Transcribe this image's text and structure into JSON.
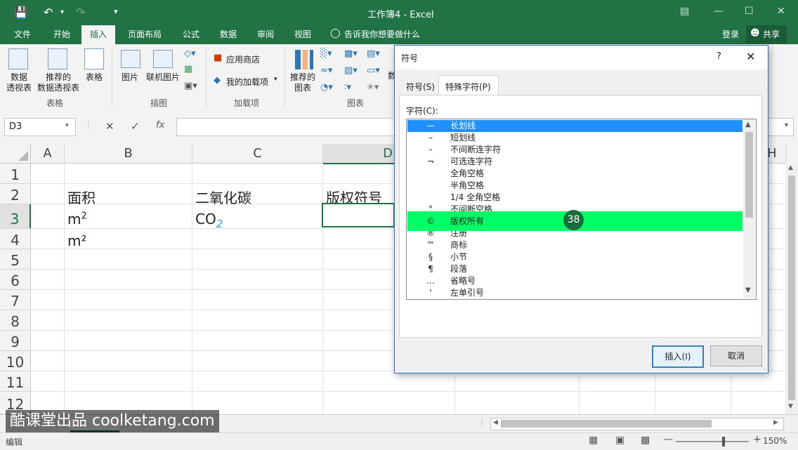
{
  "window": {
    "title": "工作簿4 - Excel"
  },
  "ribbon_tabs": [
    "文件",
    "开始",
    "插入",
    "页面布局",
    "公式",
    "数据",
    "审阅",
    "视图"
  ],
  "tell_me": "告诉我你想要做什么",
  "account": {
    "login": "登录",
    "share": "共享"
  },
  "ribbon": {
    "tables": {
      "pivot": "数据\n透视表",
      "recommended_pivot": "推荐的\n数据透视表",
      "table": "表格",
      "group": "表格"
    },
    "illustrations": {
      "pictures": "图片",
      "online_pictures": "联机图片",
      "group": "插图"
    },
    "addins": {
      "store": "应用商店",
      "my_addins": "我的加载项",
      "group": "加载项"
    },
    "charts": {
      "recommended": "推荐的\n图表",
      "next": "数",
      "group": "图表"
    }
  },
  "formula_bar": {
    "name_box": "D3",
    "fx": "fx"
  },
  "columns": [
    "A",
    "B",
    "C",
    "D",
    "H"
  ],
  "rows": [
    "1",
    "2",
    "3",
    "4",
    "5",
    "6",
    "7",
    "8",
    "9",
    "10",
    "11",
    "12"
  ],
  "cells": {
    "B2": "面积",
    "C2": "二氧化碳",
    "D2": "版权符号",
    "B3_base": "m",
    "B3_sup": "2",
    "C3_base": "CO",
    "C3_sub": "2",
    "B4": "m²"
  },
  "dialog": {
    "title": "符号",
    "help": "?",
    "tabs": [
      {
        "label": "符号(S)"
      },
      {
        "label": "特殊字符(P)"
      }
    ],
    "list_label": "字符(C):",
    "items": [
      {
        "sym": "—",
        "name": "长划线"
      },
      {
        "sym": "–",
        "name": "短划线"
      },
      {
        "sym": "-",
        "name": "不间断连字符"
      },
      {
        "sym": "¬",
        "name": "可选连字符"
      },
      {
        "sym": "",
        "name": "全角空格"
      },
      {
        "sym": "",
        "name": "半角空格"
      },
      {
        "sym": "",
        "name": "1/4 全角空格"
      },
      {
        "sym": "°",
        "name": "不间断空格"
      },
      {
        "sym": "©",
        "name": "版权所有"
      },
      {
        "sym": "®",
        "name": "注册"
      },
      {
        "sym": "™",
        "name": "商标"
      },
      {
        "sym": "§",
        "name": "小节"
      },
      {
        "sym": "¶",
        "name": "段落"
      },
      {
        "sym": "…",
        "name": "省略号"
      },
      {
        "sym": "‘",
        "name": "左单引号"
      }
    ],
    "selected_index": 0,
    "highlight_index": 8,
    "step_badge": "38",
    "insert_button": "插入(I)",
    "cancel_button": "取消"
  },
  "status": {
    "mode": "编辑",
    "zoom": "150%"
  },
  "watermark": "酷课堂出品 coolketang.com",
  "colors": {
    "excel_green": "#217346",
    "selection_blue": "#1e90ff",
    "highlight_green": "#00ff66",
    "badge_green": "#1a6b3a"
  }
}
